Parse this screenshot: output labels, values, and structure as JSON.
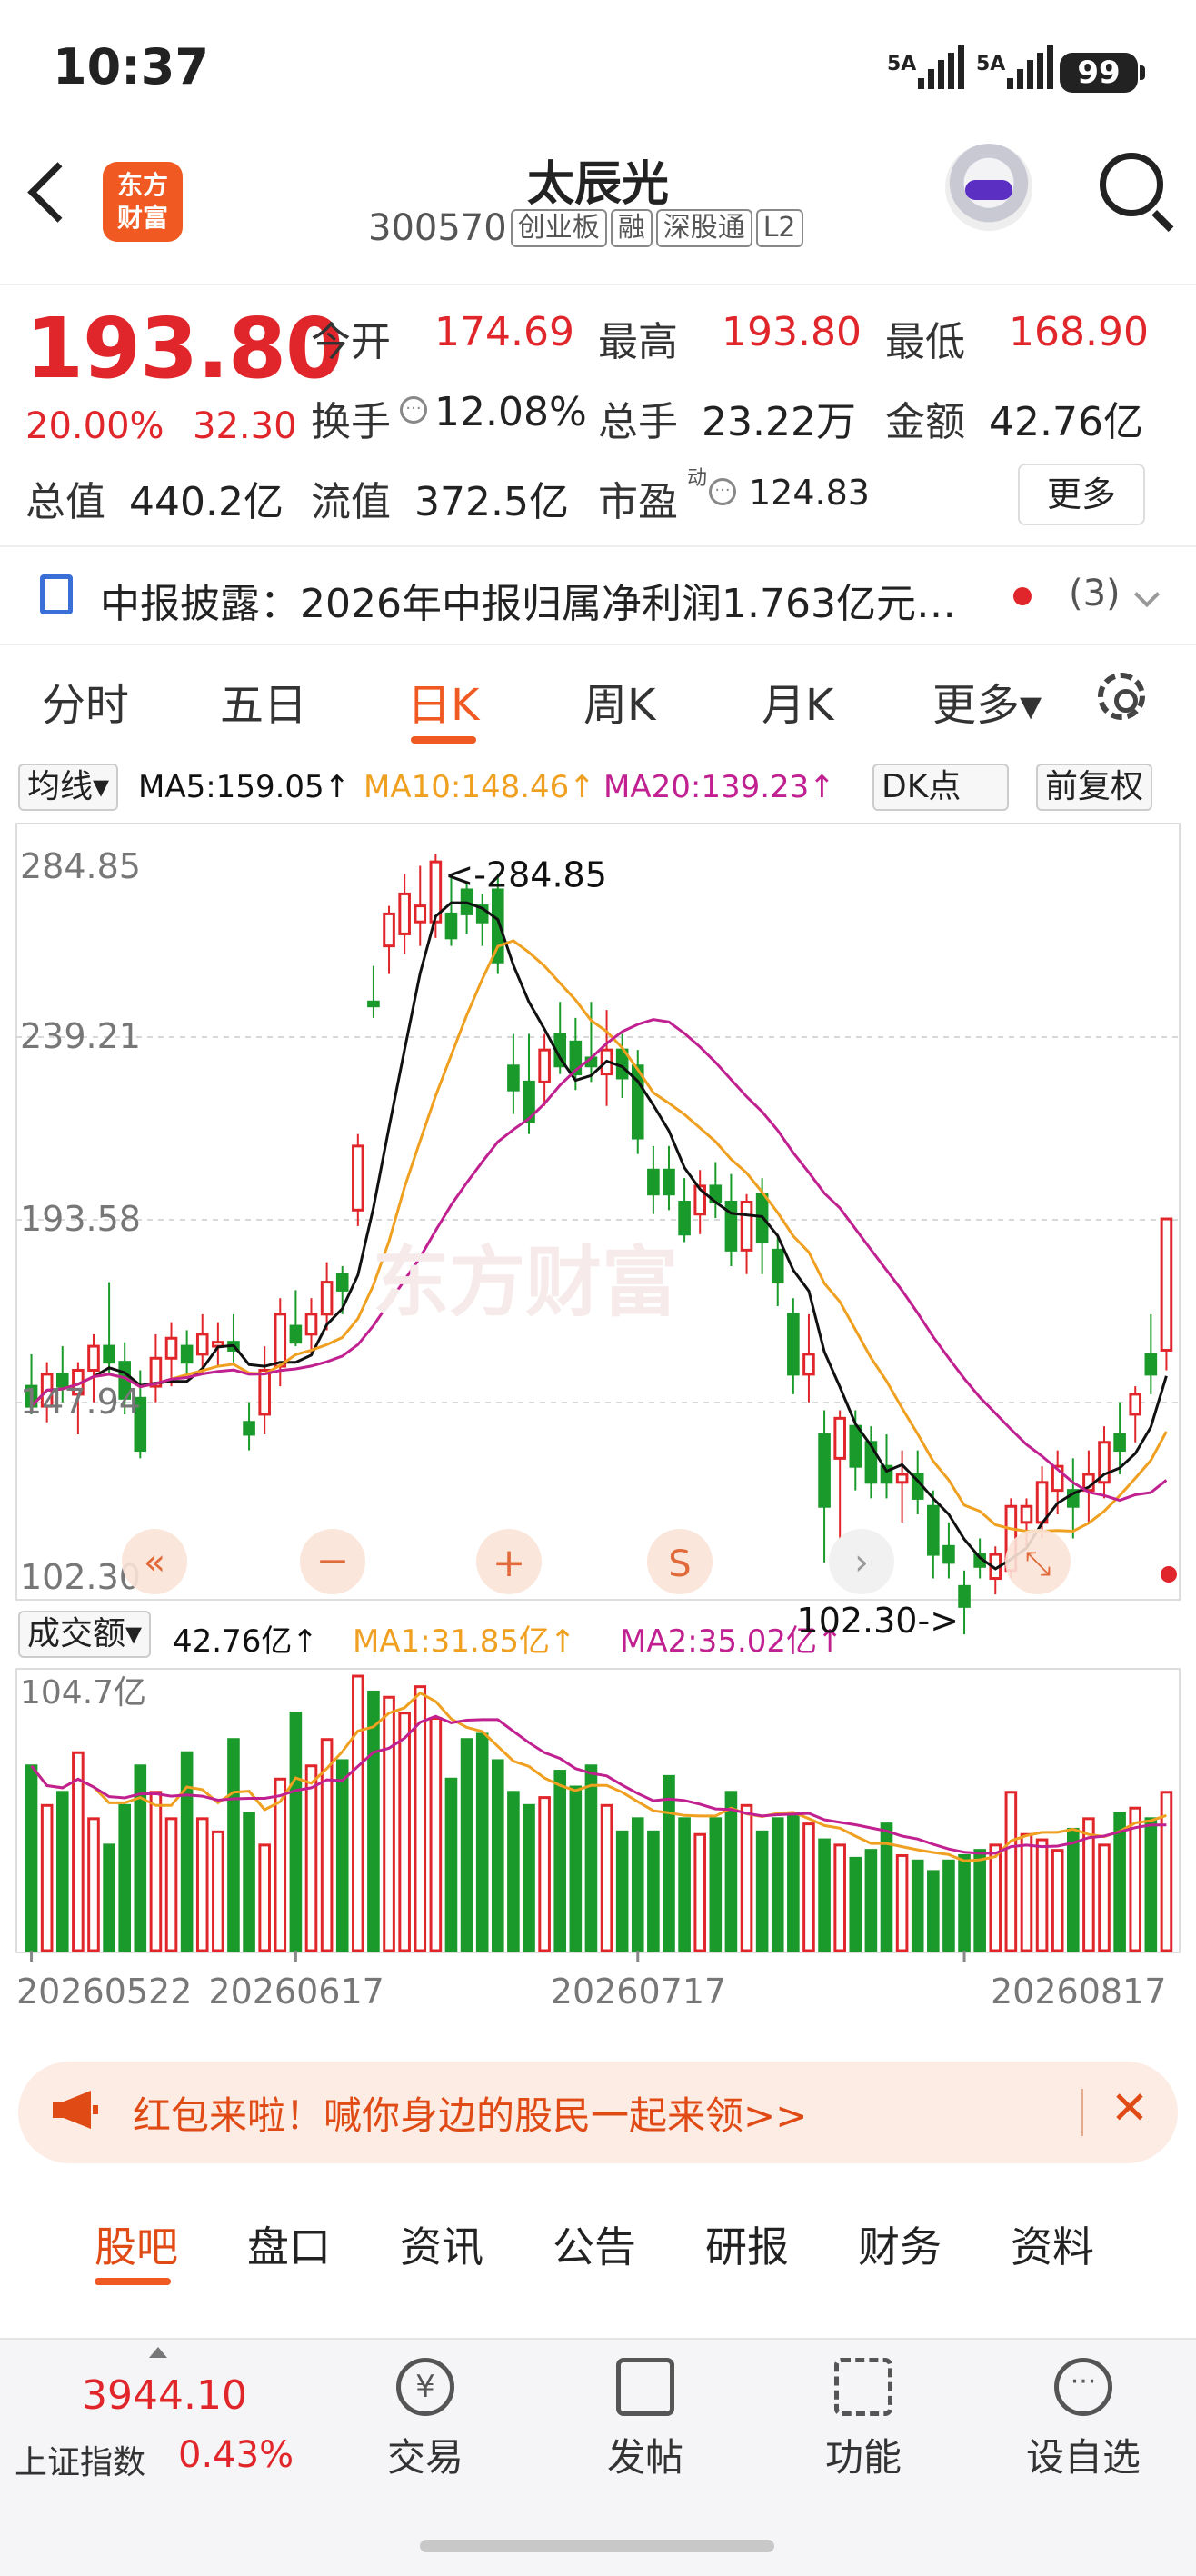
{
  "status_bar": {
    "time": "10:37",
    "signal1": "5A",
    "signal2": "5A",
    "battery": "99"
  },
  "header": {
    "logo_line1": "东方",
    "logo_line2": "财富",
    "title": "太辰光",
    "code": "300570",
    "tags": [
      "创业板",
      "融",
      "深股通",
      "L2"
    ]
  },
  "quote": {
    "price": "193.80",
    "change_pct": "20.00%",
    "change": "32.30",
    "open_label": "今开",
    "open": "174.69",
    "high_label": "最高",
    "high": "193.80",
    "low_label": "最低",
    "low": "168.90",
    "turnover_label": "换手",
    "turnover": "12.08%",
    "volume_label": "总手",
    "volume": "23.22万",
    "amount_label": "金额",
    "amount": "42.76亿",
    "mktcap_label": "总值",
    "mktcap": "440.2亿",
    "float_label": "流值",
    "float": "372.5亿",
    "pe_label": "市盈",
    "pe_sup": "动",
    "pe": "124.83",
    "more": "更多"
  },
  "notice": {
    "text": "中报披露：2026年中报归属净利润1.763亿元…",
    "count": "(3)"
  },
  "tabs": [
    "分时",
    "五日",
    "日K",
    "周K",
    "月K",
    "更多▾"
  ],
  "active_tab": 2,
  "ma_bar": {
    "selector": "均线▾",
    "ma5": "MA5:159.05↑",
    "ma10": "MA10:148.46↑",
    "ma20": "MA20:139.23↑",
    "dk": "DK点",
    "adj": "前复权"
  },
  "vol_bar": {
    "selector": "成交额▾",
    "amount": "42.76亿↑",
    "ma1": "MA1:31.85亿↑",
    "ma2": "MA2:35.02亿↑"
  },
  "colors": {
    "up": "#e0262a",
    "down": "#1a9a2a",
    "ma5": "#111111",
    "ma10": "#f0a020",
    "ma20": "#c02090",
    "accent": "#f05a22"
  },
  "chart_data": {
    "type": "candlestick",
    "y_ticks": [
      "284.85",
      "239.21",
      "193.58",
      "147.94",
      "102.30"
    ],
    "ylim": [
      102.3,
      284.85
    ],
    "high_annotation": "<-284.85",
    "low_annotation": "102.30->",
    "x_labels": [
      "20260522",
      "20260617",
      "20260717",
      "20260817"
    ],
    "volume_max_label": "104.7亿",
    "volume_max": 104.7,
    "candles": [
      [
        152,
        160,
        145,
        147
      ],
      [
        147,
        158,
        143,
        155
      ],
      [
        155,
        162,
        148,
        152
      ],
      [
        150,
        158,
        140,
        156
      ],
      [
        156,
        165,
        148,
        162
      ],
      [
        162,
        178,
        155,
        158
      ],
      [
        158,
        163,
        145,
        149
      ],
      [
        149,
        156,
        134,
        136
      ],
      [
        152,
        165,
        148,
        159
      ],
      [
        159,
        168,
        152,
        164
      ],
      [
        162,
        166,
        155,
        158
      ],
      [
        160,
        170,
        155,
        165
      ],
      [
        162,
        168,
        157,
        163
      ],
      [
        163,
        170,
        158,
        161
      ],
      [
        143,
        148,
        136,
        140
      ],
      [
        145,
        162,
        140,
        156
      ],
      [
        157,
        174,
        152,
        170
      ],
      [
        167,
        176,
        162,
        163
      ],
      [
        165,
        174,
        160,
        170
      ],
      [
        170,
        183,
        166,
        178
      ],
      [
        180,
        182,
        170,
        176
      ],
      [
        196,
        215,
        192,
        212
      ],
      [
        248,
        257,
        244,
        247
      ],
      [
        262,
        272,
        255,
        270
      ],
      [
        265,
        280,
        260,
        275
      ],
      [
        268,
        282,
        262,
        272
      ],
      [
        268,
        285,
        264,
        283
      ],
      [
        270,
        280,
        262,
        264
      ],
      [
        276,
        278,
        265,
        270
      ],
      [
        272,
        275,
        262,
        268
      ],
      [
        276,
        280,
        255,
        258
      ],
      [
        232,
        240,
        220,
        226
      ],
      [
        228,
        240,
        215,
        218
      ],
      [
        228,
        240,
        222,
        236
      ],
      [
        240,
        248,
        230,
        232
      ],
      [
        238,
        244,
        226,
        230
      ],
      [
        234,
        248,
        228,
        232
      ],
      [
        230,
        246,
        222,
        236
      ],
      [
        236,
        240,
        224,
        229
      ],
      [
        232,
        236,
        210,
        214
      ],
      [
        206,
        212,
        195,
        200
      ],
      [
        206,
        212,
        196,
        200
      ],
      [
        198,
        204,
        188,
        190
      ],
      [
        195,
        206,
        190,
        202
      ],
      [
        202,
        208,
        194,
        198
      ],
      [
        198,
        205,
        182,
        186
      ],
      [
        186,
        200,
        180,
        198
      ],
      [
        200,
        204,
        180,
        188
      ],
      [
        186,
        190,
        172,
        178
      ],
      [
        170,
        174,
        150,
        155
      ],
      [
        155,
        170,
        148,
        160
      ],
      [
        140,
        146,
        108,
        122
      ],
      [
        134,
        146,
        114,
        144
      ],
      [
        142,
        146,
        126,
        132
      ],
      [
        138,
        142,
        124,
        128
      ],
      [
        132,
        140,
        124,
        128
      ],
      [
        128,
        136,
        118,
        130
      ],
      [
        130,
        136,
        120,
        124
      ],
      [
        122,
        126,
        104,
        110
      ],
      [
        112,
        118,
        104,
        108
      ],
      [
        102,
        106,
        90,
        97
      ],
      [
        110,
        114,
        104,
        107
      ],
      [
        104,
        112,
        100,
        110
      ],
      [
        106,
        124,
        104,
        122
      ],
      [
        118,
        124,
        112,
        122
      ],
      [
        118,
        132,
        114,
        128
      ],
      [
        126,
        136,
        120,
        132
      ],
      [
        126,
        134,
        114,
        122
      ],
      [
        126,
        136,
        118,
        130
      ],
      [
        128,
        142,
        124,
        138
      ],
      [
        140,
        148,
        130,
        136
      ],
      [
        145,
        152,
        138,
        150
      ],
      [
        160,
        170,
        150,
        155
      ],
      [
        161,
        194,
        156,
        193.8
      ]
    ],
    "volume": [
      70,
      55,
      60,
      75,
      50,
      40,
      55,
      70,
      60,
      50,
      75,
      50,
      45,
      80,
      52,
      40,
      65,
      90,
      70,
      80,
      72,
      104,
      98,
      96,
      90,
      100,
      88,
      65,
      80,
      82,
      72,
      60,
      55,
      58,
      68,
      62,
      70,
      55,
      45,
      50,
      45,
      66,
      50,
      44,
      50,
      60,
      55,
      45,
      50,
      52,
      48,
      42,
      40,
      35,
      38,
      48,
      36,
      34,
      30,
      34,
      36,
      38,
      40,
      60,
      44,
      42,
      38,
      46,
      50,
      40,
      52,
      54,
      50,
      60
    ]
  },
  "banner": {
    "text": "红包来啦！喊你身边的股民一起来领>>",
    "close": "✕"
  },
  "bottom_tabs": [
    "股吧",
    "盘口",
    "资讯",
    "公告",
    "研报",
    "财务",
    "资料"
  ],
  "index": {
    "value": "3944.10",
    "name": "上证指数",
    "change": "0.43%"
  },
  "nav": [
    "交易",
    "发帖",
    "功能",
    "设自选"
  ]
}
